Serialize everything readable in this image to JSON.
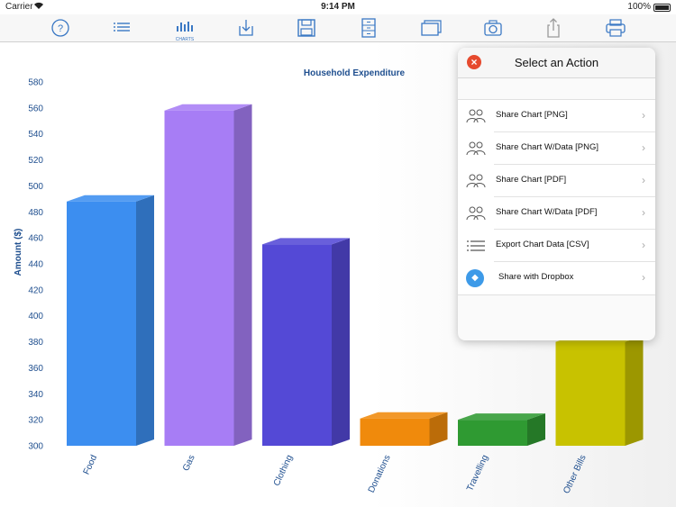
{
  "status_bar": {
    "carrier": "Carrier",
    "time": "9:14 PM",
    "battery": "100%"
  },
  "toolbar": {
    "icons": [
      "help-icon",
      "list-icon",
      "charts-icon",
      "download-icon",
      "save-icon",
      "cabinet-icon",
      "windows-icon",
      "camera-icon",
      "share-icon",
      "print-icon"
    ],
    "charts_label": "CHARTS",
    "accent": "#3a78c4"
  },
  "chart_data": {
    "type": "bar",
    "title": "Household Expenditure",
    "xlabel": "",
    "ylabel": "Amount ($)",
    "categories": [
      "Food",
      "Gas",
      "Clothing",
      "Donations",
      "Travelling",
      "Other Bills"
    ],
    "values": [
      488,
      558,
      455,
      321,
      320,
      380
    ],
    "colors": [
      "#3c8ef0",
      "#a77df5",
      "#5449d6",
      "#f08a0c",
      "#2f9a32",
      "#c8c200"
    ],
    "ylim": [
      300,
      580
    ],
    "yticks": [
      300,
      320,
      340,
      360,
      380,
      400,
      420,
      440,
      460,
      480,
      500,
      520,
      540,
      560,
      580
    ],
    "grid": false,
    "style": "3d"
  },
  "action_panel": {
    "title": "Select an Action",
    "items": [
      {
        "label": "Share Chart [PNG]",
        "icon": "people-icon"
      },
      {
        "label": "Share Chart W/Data [PNG]",
        "icon": "people-icon"
      },
      {
        "label": "Share Chart [PDF]",
        "icon": "people-icon"
      },
      {
        "label": "Share Chart W/Data [PDF]",
        "icon": "people-icon"
      },
      {
        "label": "Export Chart Data [CSV]",
        "icon": "list-icon"
      },
      {
        "label": "Share with Dropbox",
        "icon": "dropbox-icon"
      }
    ],
    "chevron": "›",
    "close": "×"
  }
}
